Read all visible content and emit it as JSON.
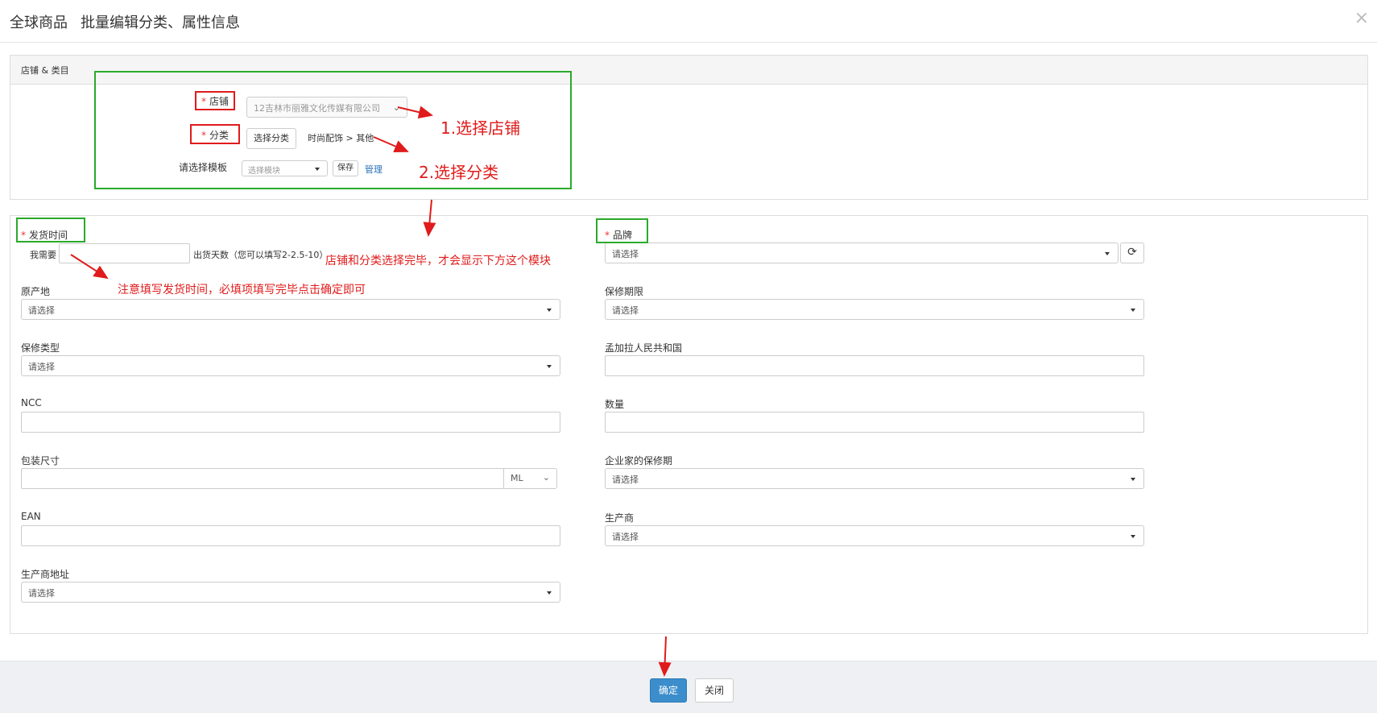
{
  "header": {
    "title": "全球商品",
    "subtitle": "批量编辑分类、属性信息",
    "close_glyph": "×"
  },
  "store_panel": {
    "heading": "店铺 & 类目",
    "store_label": "店铺",
    "store_value": "12吉林市丽雅文化传媒有限公司",
    "category_label": "分类",
    "category_button": "选择分类",
    "category_path": "时尚配饰 > 其他",
    "template_label": "请选择模板",
    "template_placeholder": "选择模块",
    "save_button": "保存",
    "manage_link": "管理"
  },
  "attrs": {
    "ship_time_label": "发货时间",
    "ship_prefix": "我需要",
    "ship_suffix": "出货天数（您可以填写2-2.5-10）",
    "brand_label": "品牌",
    "brand_value": "请选择",
    "origin_label": "原产地",
    "origin_value": "请选择",
    "warranty_period_label": "保修期限",
    "warranty_period_value": "请选择",
    "warranty_type_label": "保修类型",
    "warranty_type_value": "请选择",
    "bangladesh_label": "孟加拉人民共和国",
    "ncc_label": "NCC",
    "quantity_label": "数量",
    "package_size_label": "包装尺寸",
    "package_unit": "ML",
    "enterprise_warranty_label": "企业家的保修期",
    "enterprise_warranty_value": "请选择",
    "ean_label": "EAN",
    "manufacturer_label": "生产商",
    "manufacturer_value": "请选择",
    "manufacturer_address_label": "生产商地址",
    "manufacturer_address_value": "请选择"
  },
  "annotations": {
    "step1": "1.选择店铺",
    "step2": "2.选择分类",
    "module_note": "店铺和分类选择完毕，才会显示下方这个模块",
    "ship_note": "注意填写发货时间，必填项填写完毕点击确定即可"
  },
  "footer": {
    "confirm": "确定",
    "close": "关闭"
  },
  "colors": {
    "annotation_red": "#e01b1b",
    "annotation_green": "#2aaa2a",
    "primary": "#3c8dcb"
  }
}
